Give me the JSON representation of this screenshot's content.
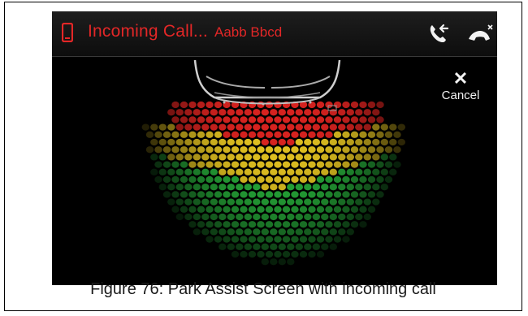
{
  "call_bar": {
    "title": "Incoming Call...",
    "caller": "Aabb Bbcd",
    "accent_color": "#e32727",
    "icons": [
      "phone-icon",
      "accept-call-icon",
      "reject-call-icon"
    ]
  },
  "cancel": {
    "glyph": "✕",
    "label": "Cancel"
  },
  "sensor_zones": {
    "colors": {
      "far": "#27ae3a",
      "mid": "#e0c020",
      "near": "#d6221f"
    },
    "order_from_car": [
      "near",
      "mid",
      "far"
    ]
  },
  "caption": "Figure 76: Park Assist Screen with incoming call"
}
